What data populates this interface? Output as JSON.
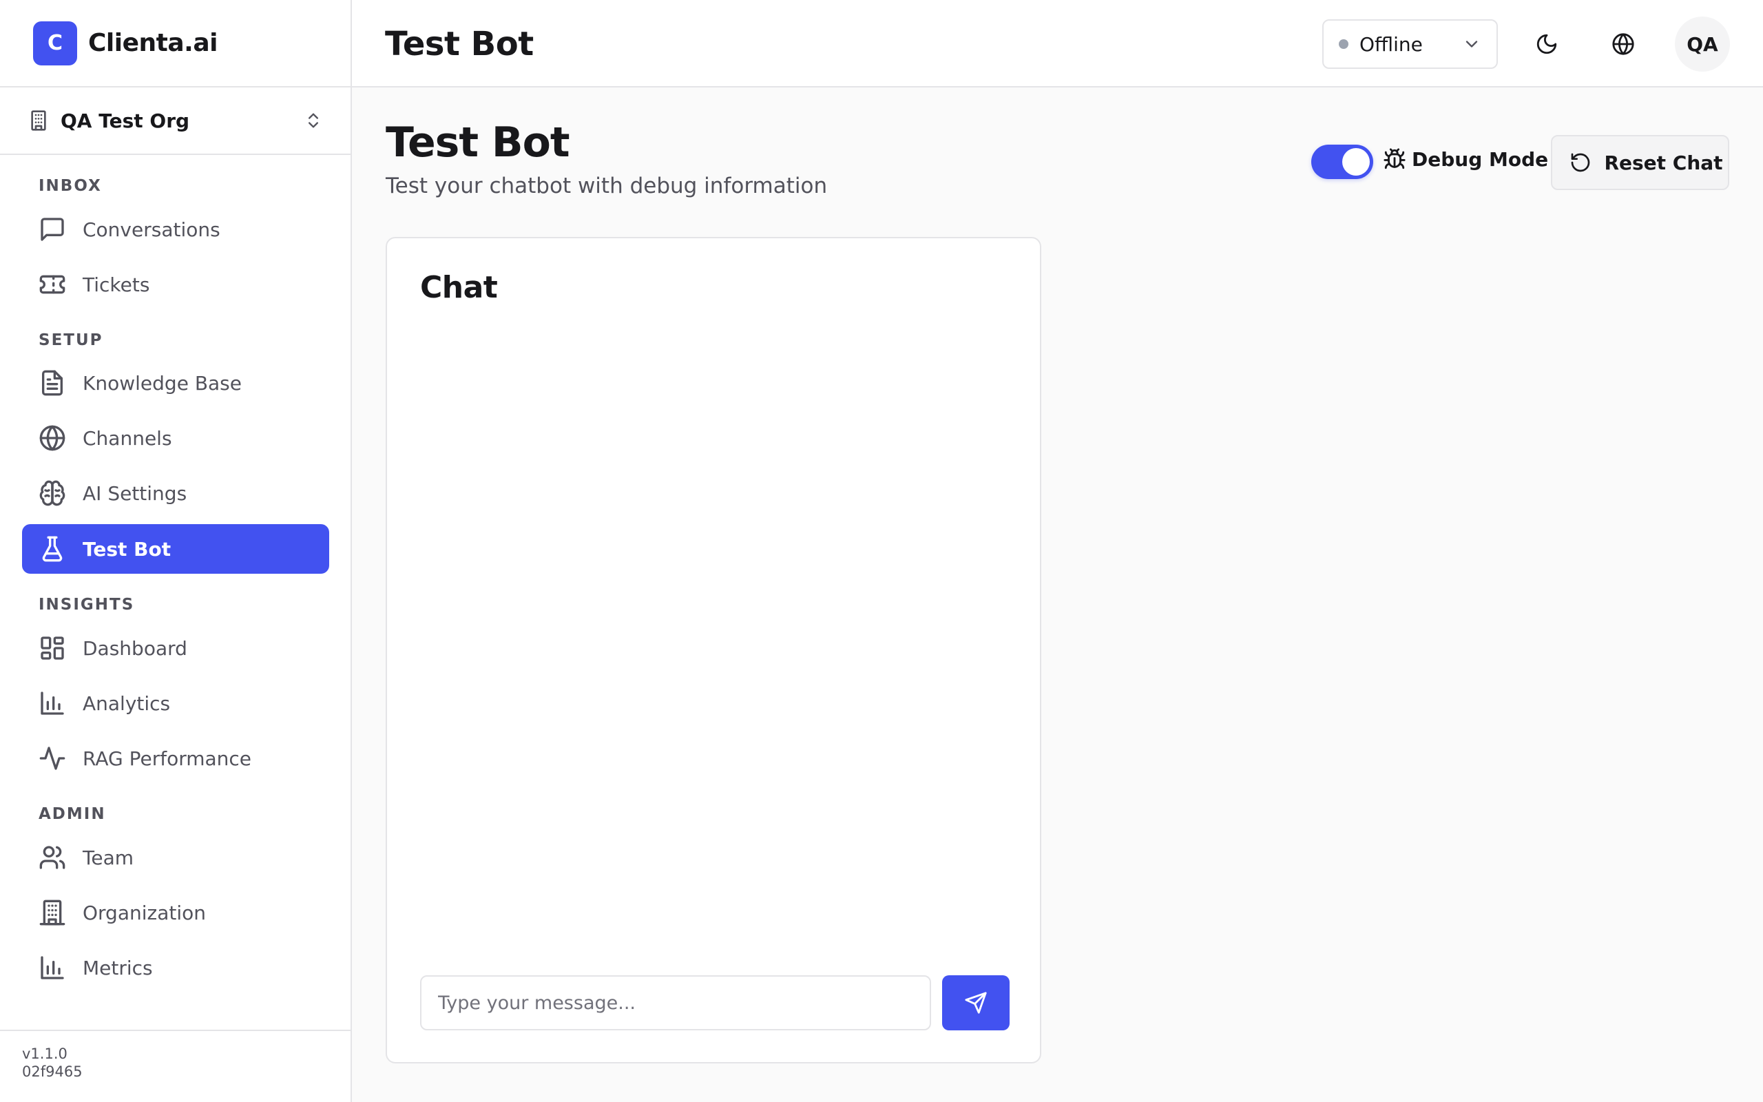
{
  "brand": {
    "logo_letter": "C",
    "name": "Clienta.ai"
  },
  "org": {
    "name": "QA Test Org"
  },
  "nav": {
    "sections": {
      "inbox": "INBOX",
      "setup": "SETUP",
      "insights": "INSIGHTS",
      "admin": "ADMIN"
    },
    "items": {
      "conversations": "Conversations",
      "tickets": "Tickets",
      "knowledge_base": "Knowledge Base",
      "channels": "Channels",
      "ai_settings": "AI Settings",
      "test_bot": "Test Bot",
      "dashboard": "Dashboard",
      "analytics": "Analytics",
      "rag_performance": "RAG Performance",
      "team": "Team",
      "organization": "Organization",
      "metrics": "Metrics"
    },
    "active": "test_bot"
  },
  "footer": {
    "version": "v1.1.0",
    "build": "02f9465"
  },
  "header": {
    "title": "Test Bot",
    "status": "Offline",
    "avatar_initials": "QA"
  },
  "main": {
    "title": "Test Bot",
    "subtitle": "Test your chatbot with debug information",
    "debug_mode_label": "Debug Mode",
    "debug_mode_on": true,
    "reset_label": "Reset Chat"
  },
  "chat": {
    "title": "Chat",
    "input_placeholder": "Type your message..."
  },
  "colors": {
    "accent": "#4252f0",
    "status_offline": "#9ca3af"
  }
}
